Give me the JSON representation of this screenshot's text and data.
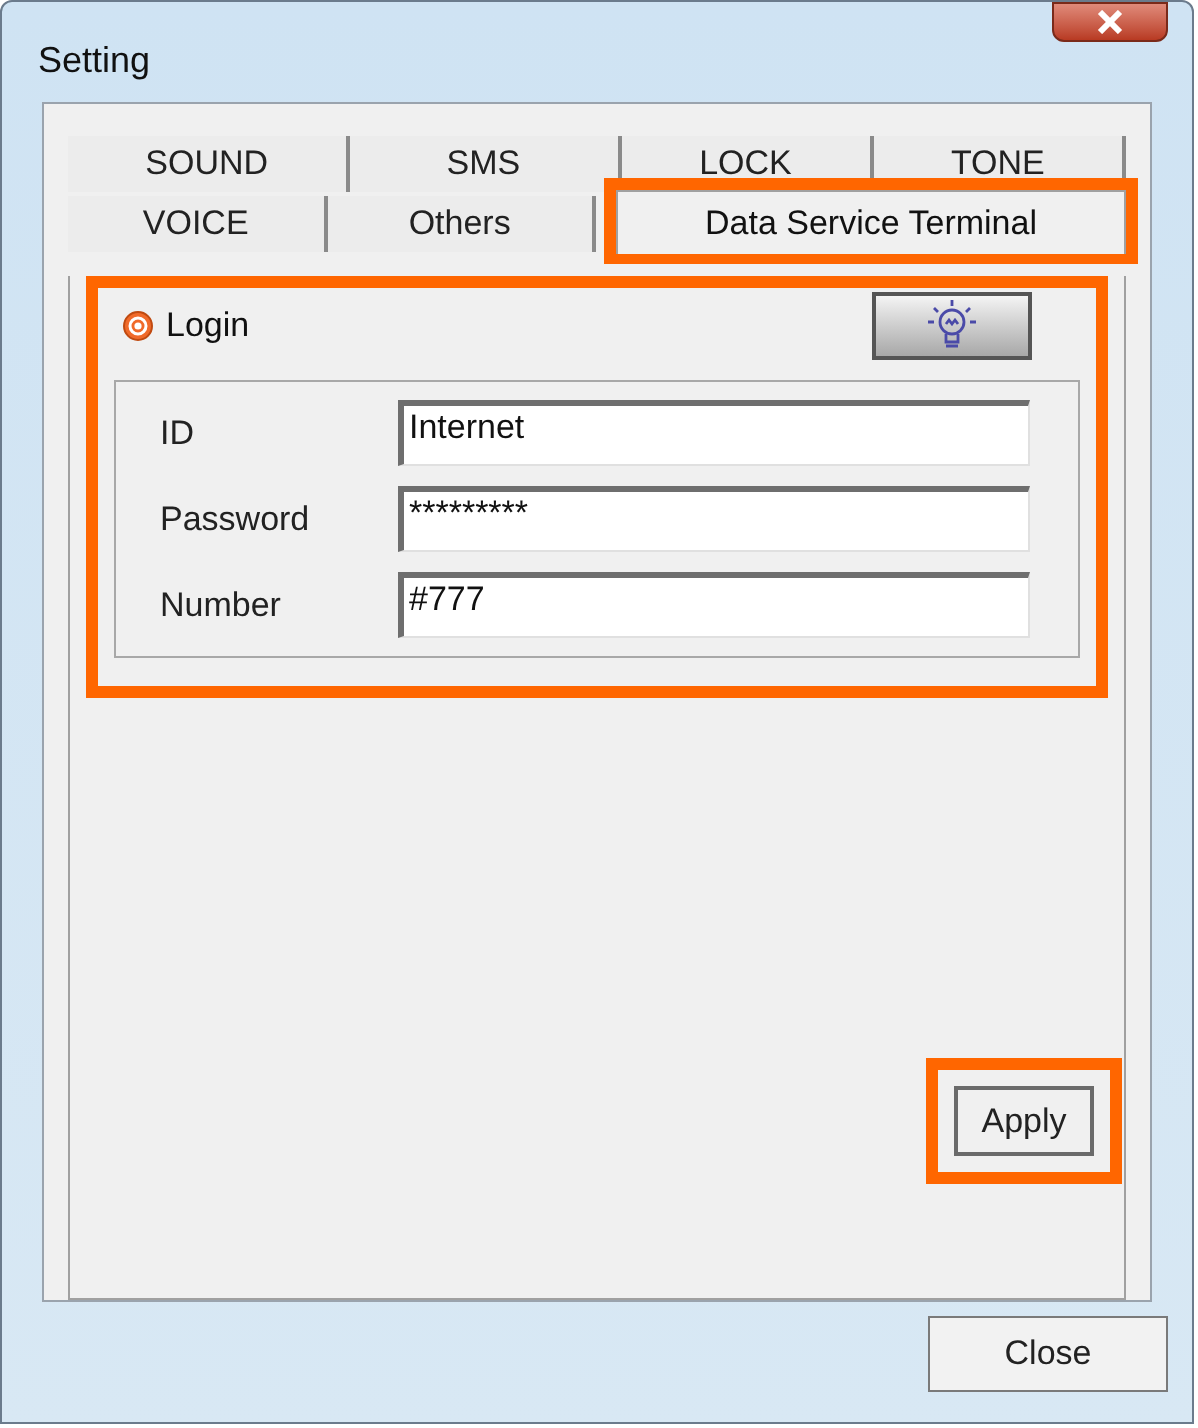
{
  "window": {
    "title": "Setting"
  },
  "tab_rows": [
    [
      {
        "label": "SOUND",
        "selected": false,
        "highlighted": false
      },
      {
        "label": "SMS",
        "selected": false,
        "highlighted": false
      },
      {
        "label": "LOCK",
        "selected": false,
        "highlighted": false
      },
      {
        "label": "TONE",
        "selected": false,
        "highlighted": false
      }
    ],
    [
      {
        "label": "VOICE",
        "selected": false,
        "highlighted": false
      },
      {
        "label": "Others",
        "selected": false,
        "highlighted": false
      },
      {
        "label": "Data Service Terminal",
        "selected": true,
        "highlighted": true
      }
    ]
  ],
  "login": {
    "label": "Login",
    "selected": true,
    "highlighted": true,
    "fields": [
      {
        "label": "ID",
        "value": "Internet"
      },
      {
        "label": "Password",
        "value": "*********"
      },
      {
        "label": "Number",
        "value": "#777"
      }
    ]
  },
  "apply_button": {
    "label": "Apply",
    "highlighted": true
  },
  "close_button": {
    "label": "Close"
  }
}
